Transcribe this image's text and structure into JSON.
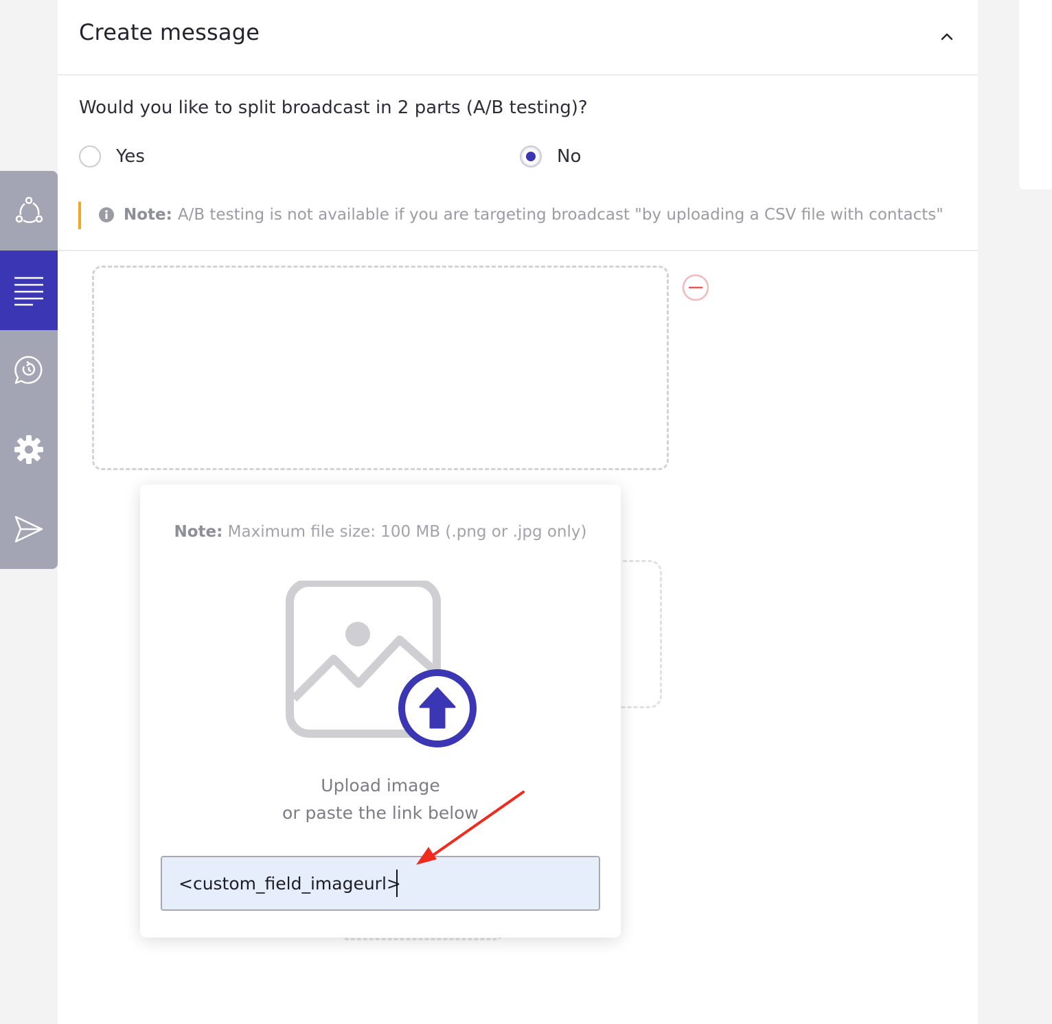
{
  "panel": {
    "title": "Create message"
  },
  "ab_testing": {
    "question": "Would you like to split broadcast in 2 parts (A/B testing)?",
    "options": [
      {
        "label": "Yes",
        "selected": false
      },
      {
        "label": "No",
        "selected": true
      }
    ],
    "note_label": "Note:",
    "note_text": "A/B testing is not available if you are targeting broadcast \"by uploading a CSV file with contacts\""
  },
  "sidebar": {
    "items": [
      {
        "icon": "segments-icon",
        "active": false
      },
      {
        "icon": "text-lines-icon",
        "active": true
      },
      {
        "icon": "whatsapp-icon",
        "active": false
      },
      {
        "icon": "gear-icon",
        "active": false
      },
      {
        "icon": "send-icon",
        "active": false
      }
    ]
  },
  "upload_popover": {
    "note_label": "Note:",
    "note_text": "Maximum file size: 100 MB (.png or .jpg only)",
    "upload_line1": "Upload image",
    "upload_line2": "or paste the link below",
    "link_input_value": "<custom_field_imageurl>"
  },
  "colors": {
    "accent": "#3b36b3",
    "sidebar": "#a3a5b4",
    "note_bar": "#f5a623",
    "annotation_arrow": "#f02a1c",
    "remove": "#e8565a"
  }
}
